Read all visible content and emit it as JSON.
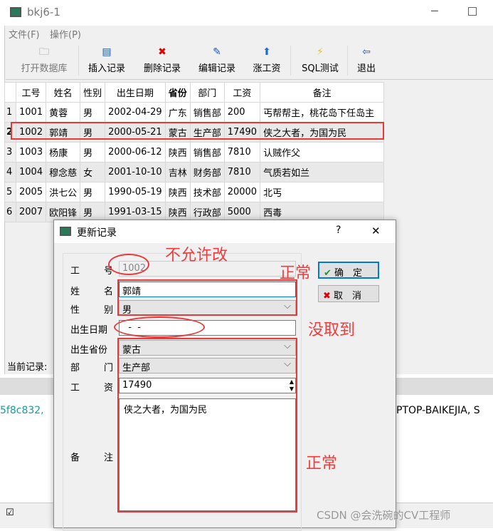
{
  "window": {
    "title": "bkj6-1",
    "menu": [
      "文件(F)",
      "操作(P)"
    ]
  },
  "toolbar": [
    {
      "label": "打开数据库",
      "icon": "folder-icon"
    },
    {
      "label": "插入记录",
      "icon": "insert-icon"
    },
    {
      "label": "删除记录",
      "icon": "delete-icon"
    },
    {
      "label": "编辑记录",
      "icon": "edit-icon"
    },
    {
      "label": "涨工资",
      "icon": "arrow-up-icon"
    },
    {
      "label": "SQL测试",
      "icon": "lightning-icon"
    },
    {
      "label": "退出",
      "icon": "exit-icon"
    }
  ],
  "table": {
    "headers": [
      "工号",
      "姓名",
      "性别",
      "出生日期",
      "省份",
      "部门",
      "工资",
      "备注"
    ],
    "rows": [
      [
        "1",
        "1001",
        "黄蓉",
        "男",
        "2002-04-29",
        "广东",
        "销售部",
        "200",
        "丐帮帮主，桃花岛下任岛主"
      ],
      [
        "2",
        "1002",
        "郭靖",
        "男",
        "2000-05-21",
        "蒙古",
        "生产部",
        "17490",
        "侠之大者，为国为民"
      ],
      [
        "3",
        "1003",
        "杨康",
        "男",
        "2000-06-12",
        "陕西",
        "销售部",
        "7810",
        "认贼作父"
      ],
      [
        "4",
        "1004",
        "穆念慈",
        "女",
        "2001-10-10",
        "吉林",
        "财务部",
        "7810",
        "气质若如兰"
      ],
      [
        "5",
        "2005",
        "洪七公",
        "男",
        "1990-05-19",
        "陕西",
        "技术部",
        "20000",
        "北丐"
      ],
      [
        "6",
        "2007",
        "欧阳锋",
        "男",
        "1991-03-15",
        "陕西",
        "行政部",
        "5000",
        "西毒"
      ]
    ]
  },
  "status": "当前记录:",
  "background_text": {
    "left": "5f8c832,",
    "right": "PTOP-BAIKEJIA, S"
  },
  "dialog": {
    "title": "更新记录",
    "help": "?",
    "close": "✕",
    "labels": {
      "id": [
        "工",
        "号"
      ],
      "name": [
        "姓",
        "名"
      ],
      "gender": [
        "性",
        "别"
      ],
      "birth": "出生日期",
      "province": "出生省份",
      "dept": [
        "部",
        "门"
      ],
      "salary": [
        "工",
        "资"
      ],
      "note": [
        "备",
        "注"
      ]
    },
    "values": {
      "id": "1002",
      "name": "郭靖",
      "gender": "男",
      "birth": "  -  -  ",
      "province": "蒙古",
      "dept": "生产部",
      "salary": "17490",
      "note": "侠之大者，为国为民"
    },
    "ok": "确　定",
    "cancel": "取　消"
  },
  "annotations": {
    "no_edit": "不允许改",
    "normal1": "正常",
    "missing": "没取到",
    "normal2": "正常"
  },
  "watermark": "CSDN @会洗碗的CV工程师"
}
